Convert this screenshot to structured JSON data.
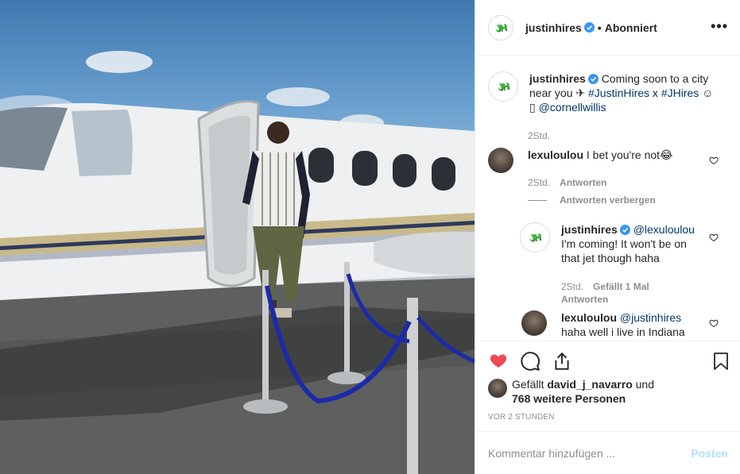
{
  "post": {
    "owner": "justinhires",
    "owner_avatar_text": "JH",
    "follow_status": "Abonniert",
    "more_icon": "ellipsis-icon"
  },
  "caption": {
    "username": "justinhires",
    "text_before": "Coming soon to a city near you ✈ ",
    "hashtag1": "#JustinHires",
    "x": " x ",
    "hashtag2": "#JHires",
    "emoji": " ☺",
    "line2_glyph": "▯ ",
    "mention": "@cornellwillis",
    "time": "2Std."
  },
  "comments": [
    {
      "username": "lexuloulou",
      "text": "I bet you're not😂",
      "time": "2Std.",
      "reply_label": "Antworten",
      "hide_replies": "Antworten verbergen"
    },
    {
      "username": "justinhires",
      "mention": "@lexuloulou",
      "text": "I'm coming! It won't be on that jet though haha",
      "time": "2Std.",
      "likes_label": "Gefällt 1 Mal",
      "reply_label": "Antworten"
    },
    {
      "username": "lexuloulou",
      "mention": "@justinhires",
      "text": "haha well i live in Indiana"
    }
  ],
  "likes": {
    "prefix": "Gefällt",
    "user": "david_j_navarro",
    "mid": "und",
    "rest": "768 weitere Personen"
  },
  "timestamp": "VOR 2 STUNDEN",
  "add_comment": {
    "placeholder": "Kommentar hinzufügen ...",
    "post_label": "Posten"
  },
  "colors": {
    "liked_heart": "#ed4956",
    "link": "#00376b",
    "verified": "#3897f0",
    "post_disabled": "#b2dffc"
  }
}
